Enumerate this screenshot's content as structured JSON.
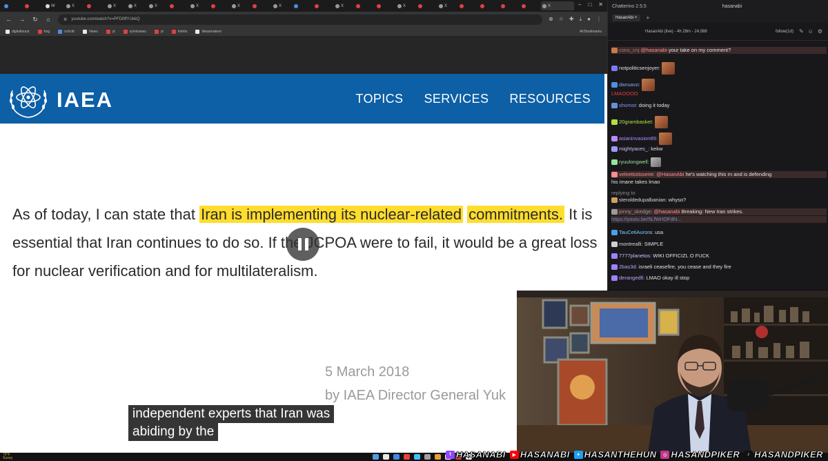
{
  "browser": {
    "tabs": [
      {
        "label": "",
        "color": "#4a90e2"
      },
      {
        "label": "",
        "color": "#e04040"
      },
      {
        "label": "W",
        "color": "#dddddd"
      },
      {
        "label": "X",
        "color": "#999999"
      },
      {
        "label": "",
        "color": "#e04040"
      },
      {
        "label": "X",
        "color": "#999999"
      },
      {
        "label": "X",
        "color": "#999999"
      },
      {
        "label": "X",
        "color": "#999999"
      },
      {
        "label": "",
        "color": "#e04040"
      },
      {
        "label": "X",
        "color": "#999999"
      },
      {
        "label": "",
        "color": "#e04040"
      },
      {
        "label": "X",
        "color": "#999999"
      },
      {
        "label": "",
        "color": "#e04040"
      },
      {
        "label": "X",
        "color": "#999999"
      },
      {
        "label": "",
        "color": "#4a90e2"
      },
      {
        "label": "",
        "color": "#e04040"
      },
      {
        "label": "X",
        "color": "#999999"
      },
      {
        "label": "",
        "color": "#e04040"
      },
      {
        "label": "",
        "color": "#e04040"
      },
      {
        "label": "X",
        "color": "#999999"
      },
      {
        "label": "",
        "color": "#e04040"
      },
      {
        "label": "X",
        "color": "#999999"
      },
      {
        "label": "",
        "color": "#e04040"
      },
      {
        "label": "",
        "color": "#e04040"
      },
      {
        "label": "",
        "color": "#e04040"
      },
      {
        "label": "",
        "color": "#e04040"
      },
      {
        "label": "X",
        "color": "#999999"
      }
    ],
    "url": "youtube.com/watch?v=PFD0ffYUkkQ",
    "bookmarks": [
      "digitaltouryt",
      "frog",
      "nchcttr",
      "News",
      "yt",
      "symmanes",
      "yt",
      "tmtnts",
      "Ideasmakers"
    ],
    "bookmarks_right": "All Bookmarks"
  },
  "video": {
    "org": {
      "wordmark": "IAEA"
    },
    "nav": [
      "TOPICS",
      "SERVICES",
      "RESOURCES"
    ],
    "quote": {
      "lead": "As of today, I can state that ",
      "highlight_1": "Iran is implementing its nuclear-related",
      "highlight_2": "commitments.",
      "rest": " It is essential that Iran continues to do so. If the JCPOA were to fail, it would be a great loss for nuclear verification and for multilateralism."
    },
    "date": "5 March 2018",
    "byline": "by IAEA Director General Yuk",
    "captions": [
      "independent experts that Iran was",
      "abiding by the"
    ]
  },
  "chat": {
    "app_title": "Chatterino 2.5.5",
    "user": "hasanabi",
    "tab": "HasanAbi ×",
    "header_title": "HasanAbi (live) - 4h 28m - 24,088",
    "follow": "follow(1d)",
    "messages": [
      {
        "user": "cons_cnj",
        "mention": "@hasanabi",
        "text": "your take on my comment?",
        "color": "#a47b7b",
        "highlight": true
      },
      {
        "user": "notpoliticsenjoyer:",
        "text": "",
        "color": "#e3e3e3",
        "emote": true
      },
      {
        "user": "danuavo:",
        "text": "",
        "color": "#8fa3ff",
        "emote": true
      },
      {
        "user": "",
        "text": "LMAOOOO",
        "color": "#e34040"
      },
      {
        "user": "shomot:",
        "text": "doing it today",
        "color": "#7d9cff"
      },
      {
        "user": "20grambasket:",
        "text": "",
        "color": "#b0e040",
        "emote": true
      },
      {
        "user": "asianinvasion89:",
        "text": "",
        "color": "#b38cff",
        "emote": true
      },
      {
        "user": "mightyaces_:",
        "text": "kekw",
        "color": "#d0c0ff"
      },
      {
        "user": "ryuulongwell:",
        "text": "",
        "color": "#9be39b",
        "emote": true
      },
      {
        "user": "veleettotisserie:",
        "mention": "@HasanAbi",
        "text": "he's watching this rn and is defending",
        "color": "#ff8c8c",
        "highlight": true
      },
      {
        "user": "",
        "text": "his imane takes lmao",
        "color": "#e3e3e3"
      },
      {
        "user": "",
        "text": "replying to",
        "color": "#8a8a8a"
      },
      {
        "user": "steroldedupalbanian:",
        "text": "whyso?",
        "color": "#d9d9d9"
      },
      {
        "user": "jonny_skedge:",
        "mention": "@hasanabi",
        "text": "Breaking: New Iran strikes.",
        "color": "#9b9b9b",
        "highlight": true
      },
      {
        "user": "",
        "text": "https://youtu.be/5LfWrIOFdN...",
        "color": "#6b8fd6",
        "highlight": true
      },
      {
        "user": "TauCetiAurora:",
        "text": "usa",
        "color": "#7ad0ff"
      },
      {
        "user": "montrealli:",
        "text": "SIMPLE",
        "color": "#d9d9d9"
      },
      {
        "user": "7777planetos:",
        "text": "WIKI OFFICIZL O FUCK",
        "color": "#ccc0ff"
      },
      {
        "user": "2bas3d:",
        "text": "israeli ceasefire, you cease and they fire",
        "color": "#bfa0ff"
      },
      {
        "user": "derangedfi:",
        "text": "LMAO okay ill stop",
        "color": "#c0a0ff"
      }
    ]
  },
  "taskbar": {
    "weather": "72°F",
    "weather_sub": "Sunny",
    "icon_colors": [
      "#4aa0e8",
      "#e8e8e8",
      "#3d8ae8",
      "#e84040",
      "#40c0ff",
      "#a0a0a0",
      "#e8a030",
      "#ffffff",
      "#d04040",
      "#e8e8e8"
    ]
  },
  "socials": [
    {
      "name": "HASANABI",
      "icon": "twitch-icon",
      "glyph": "t",
      "color": "#9146ff"
    },
    {
      "name": "HASANABI",
      "icon": "youtube-icon",
      "glyph": "▶",
      "color": "#ff0000"
    },
    {
      "name": "HASANTHEHUN",
      "icon": "twitter-icon",
      "glyph": "✦",
      "color": "#1da1f2"
    },
    {
      "name": "HASANDPIKER",
      "icon": "instagram-icon",
      "glyph": "◎",
      "color": "#c13584"
    },
    {
      "name": "HASANDPIKER",
      "icon": "tiktok-icon",
      "glyph": "♪",
      "color": "#111111"
    }
  ]
}
